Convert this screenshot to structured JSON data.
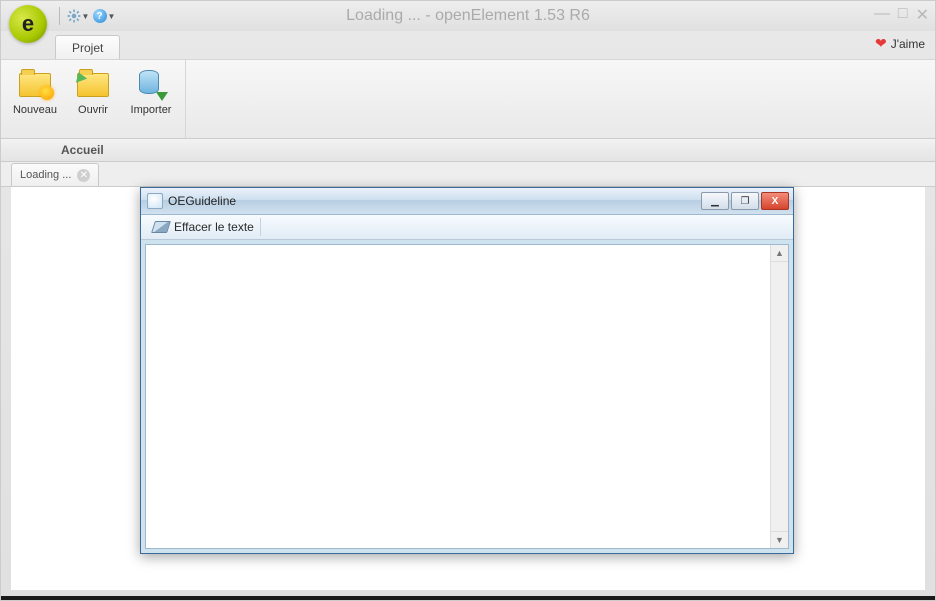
{
  "app": {
    "title": "Loading ... - openElement 1.53 R6",
    "like_label": "J'aime"
  },
  "ribbon": {
    "tab_label": "Projet",
    "buttons": {
      "new": "Nouveau",
      "open": "Ouvrir",
      "import": "Importer"
    }
  },
  "subbar": {
    "label": "Accueil"
  },
  "doc_tabs": [
    {
      "label": "Loading ..."
    }
  ],
  "dialog": {
    "title": "OEGuideline",
    "toolbar": {
      "erase_label": "Effacer le texte"
    },
    "text_value": ""
  },
  "icons": {
    "gear": "gear-icon",
    "help": "help-icon",
    "heart": "heart-icon",
    "minimize_glyph": "—",
    "maximize_glyph": "□",
    "close_glyph": "✕",
    "dlg_min_glyph": "▁",
    "dlg_max_glyph": "❐",
    "dlg_close_glyph": "X",
    "tab_close_glyph": "✕",
    "scroll_up_glyph": "▲",
    "scroll_down_glyph": "▼",
    "dropdown_glyph": "▼"
  }
}
